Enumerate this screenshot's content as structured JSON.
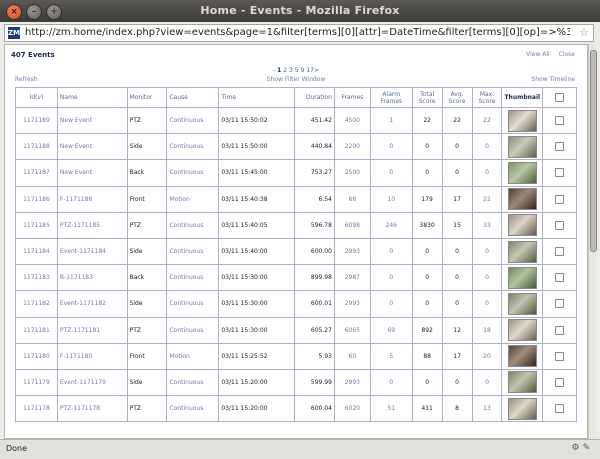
{
  "window": {
    "title": "Home - Events - Mozilla Firefox"
  },
  "urlbar": {
    "url": "http://zm.home/index.php?view=events&page=1&filter[terms][0][attr]=DateTime&filter[terms][0][op]=>%3D&filter[terms][0][val]=-1+day&f",
    "favicon": "ZM"
  },
  "header": {
    "event_count": "407 Events",
    "view_all": "View All",
    "close": "Close"
  },
  "pager": {
    "current": "1",
    "pages": [
      "2",
      "3",
      "5",
      "9",
      "17"
    ],
    "next": ">"
  },
  "toolbar": {
    "refresh": "Refresh",
    "show_filter": "Show Filter Window",
    "show_timeline": "Show Timeline"
  },
  "columns": [
    "Id(v)",
    "Name",
    "Monitor",
    "Cause",
    "Time",
    "Duration",
    "Frames",
    "Alarm Frames",
    "Total Score",
    "Avg. Score",
    "Max. Score",
    "Thumbnail"
  ],
  "rows": [
    {
      "id": "1171189",
      "name": "New Event",
      "monitor": "PTZ",
      "cause": "Continuous",
      "time": "03/11 15:50:02",
      "duration": "451.42",
      "frames": "4500",
      "alarm": "1",
      "total": "22",
      "avg": "22",
      "max": "22",
      "thumb": [
        "#a39383",
        "#e4ddd2",
        "#6b5c4e"
      ]
    },
    {
      "id": "1171188",
      "name": "New Event",
      "monitor": "Side",
      "cause": "Continuous",
      "time": "03/11 15:50:00",
      "duration": "440.84",
      "frames": "2200",
      "alarm": "0",
      "total": "0",
      "avg": "0",
      "max": "0",
      "thumb": [
        "#8a9079",
        "#c9cbb8",
        "#5c6350"
      ]
    },
    {
      "id": "1171187",
      "name": "New Event",
      "monitor": "Back",
      "cause": "Continuous",
      "time": "03/11 15:45:00",
      "duration": "753.27",
      "frames": "2500",
      "alarm": "0",
      "total": "0",
      "avg": "0",
      "max": "0",
      "thumb": [
        "#7d8f6a",
        "#b9c9a8",
        "#4d5e3c"
      ]
    },
    {
      "id": "1171186",
      "name": "F-1171186",
      "monitor": "Front",
      "cause": "Motion",
      "time": "03/11 15:40:38",
      "duration": "6.54",
      "frames": "66",
      "alarm": "10",
      "total": "179",
      "avg": "17",
      "max": "22",
      "thumb": [
        "#4f3f37",
        "#a08878",
        "#2e2420"
      ]
    },
    {
      "id": "1171185",
      "name": "PTZ-1171185",
      "monitor": "PTZ",
      "cause": "Continuous",
      "time": "03/11 15:40:05",
      "duration": "596.78",
      "frames": "6098",
      "alarm": "246",
      "total": "3830",
      "avg": "15",
      "max": "33",
      "thumb": [
        "#9a8f80",
        "#dcd5c8",
        "#645a4d"
      ]
    },
    {
      "id": "1171184",
      "name": "Event-1171184",
      "monitor": "Side",
      "cause": "Continuous",
      "time": "03/11 15:40:00",
      "duration": "600.00",
      "frames": "2993",
      "alarm": "0",
      "total": "0",
      "avg": "0",
      "max": "0",
      "thumb": [
        "#7f8771",
        "#c4c8b4",
        "#545b47"
      ]
    },
    {
      "id": "1171183",
      "name": "B-1171183",
      "monitor": "Back",
      "cause": "Continuous",
      "time": "03/11 15:30:00",
      "duration": "899.98",
      "frames": "2987",
      "alarm": "0",
      "total": "0",
      "avg": "0",
      "max": "0",
      "thumb": [
        "#708561",
        "#b2c49e",
        "#465a37"
      ]
    },
    {
      "id": "1171182",
      "name": "Event-1171182",
      "monitor": "Side",
      "cause": "Continuous",
      "time": "03/11 15:30:00",
      "duration": "600.01",
      "frames": "2993",
      "alarm": "0",
      "total": "0",
      "avg": "0",
      "max": "0",
      "thumb": [
        "#7a826b",
        "#c0c4af",
        "#50573f"
      ]
    },
    {
      "id": "1171181",
      "name": "PTZ-1171181",
      "monitor": "PTZ",
      "cause": "Continuous",
      "time": "03/11 15:30:00",
      "duration": "605.27",
      "frames": "6065",
      "alarm": "69",
      "total": "892",
      "avg": "12",
      "max": "18",
      "thumb": [
        "#a09585",
        "#e0d9cc",
        "#6a6052"
      ]
    },
    {
      "id": "1171180",
      "name": "F-1171180",
      "monitor": "Front",
      "cause": "Motion",
      "time": "03/11 15:25:52",
      "duration": "5.93",
      "frames": "60",
      "alarm": "5",
      "total": "88",
      "avg": "17",
      "max": "20",
      "thumb": [
        "#53443b",
        "#a38d7d",
        "#2f2520"
      ]
    },
    {
      "id": "1171179",
      "name": "Event-1171179",
      "monitor": "Side",
      "cause": "Continuous",
      "time": "03/11 15:20:00",
      "duration": "599.99",
      "frames": "2993",
      "alarm": "0",
      "total": "0",
      "avg": "0",
      "max": "0",
      "thumb": [
        "#7c846d",
        "#c1c5b0",
        "#51583f"
      ]
    },
    {
      "id": "1171178",
      "name": "PTZ-1171178",
      "monitor": "PTZ",
      "cause": "Continuous",
      "time": "03/11 15:20:00",
      "duration": "600.04",
      "frames": "6020",
      "alarm": "51",
      "total": "411",
      "avg": "8",
      "max": "13",
      "thumb": [
        "#9d9282",
        "#ded7ca",
        "#675d4f"
      ]
    }
  ],
  "statusbar": {
    "text": "Done"
  }
}
